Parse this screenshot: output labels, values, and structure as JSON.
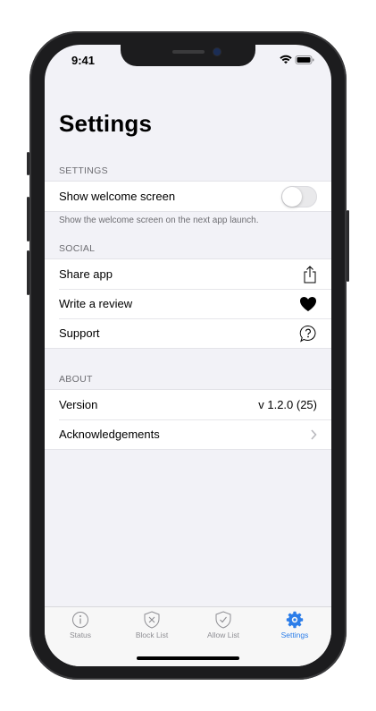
{
  "status_bar": {
    "time": "9:41"
  },
  "title": "Settings",
  "sections": {
    "settings": {
      "header": "SETTINGS",
      "welcome_label": "Show welcome screen",
      "welcome_enabled": false,
      "footer": "Show the welcome screen on the next app launch."
    },
    "social": {
      "header": "SOCIAL",
      "items": [
        {
          "label": "Share app",
          "icon": "share-icon"
        },
        {
          "label": "Write a review",
          "icon": "heart-icon"
        },
        {
          "label": "Support",
          "icon": "question-bubble-icon"
        }
      ]
    },
    "about": {
      "header": "ABOUT",
      "version_label": "Version",
      "version_value": "v 1.2.0 (25)",
      "ack_label": "Acknowledgements"
    }
  },
  "tab_bar": {
    "tabs": [
      {
        "label": "Status",
        "icon": "info-icon"
      },
      {
        "label": "Block List",
        "icon": "shield-x-icon"
      },
      {
        "label": "Allow List",
        "icon": "shield-check-icon"
      },
      {
        "label": "Settings",
        "icon": "gear-icon"
      }
    ],
    "active_index": 3,
    "accent_color": "#2b7de9",
    "inactive_color": "#8e8e93"
  }
}
